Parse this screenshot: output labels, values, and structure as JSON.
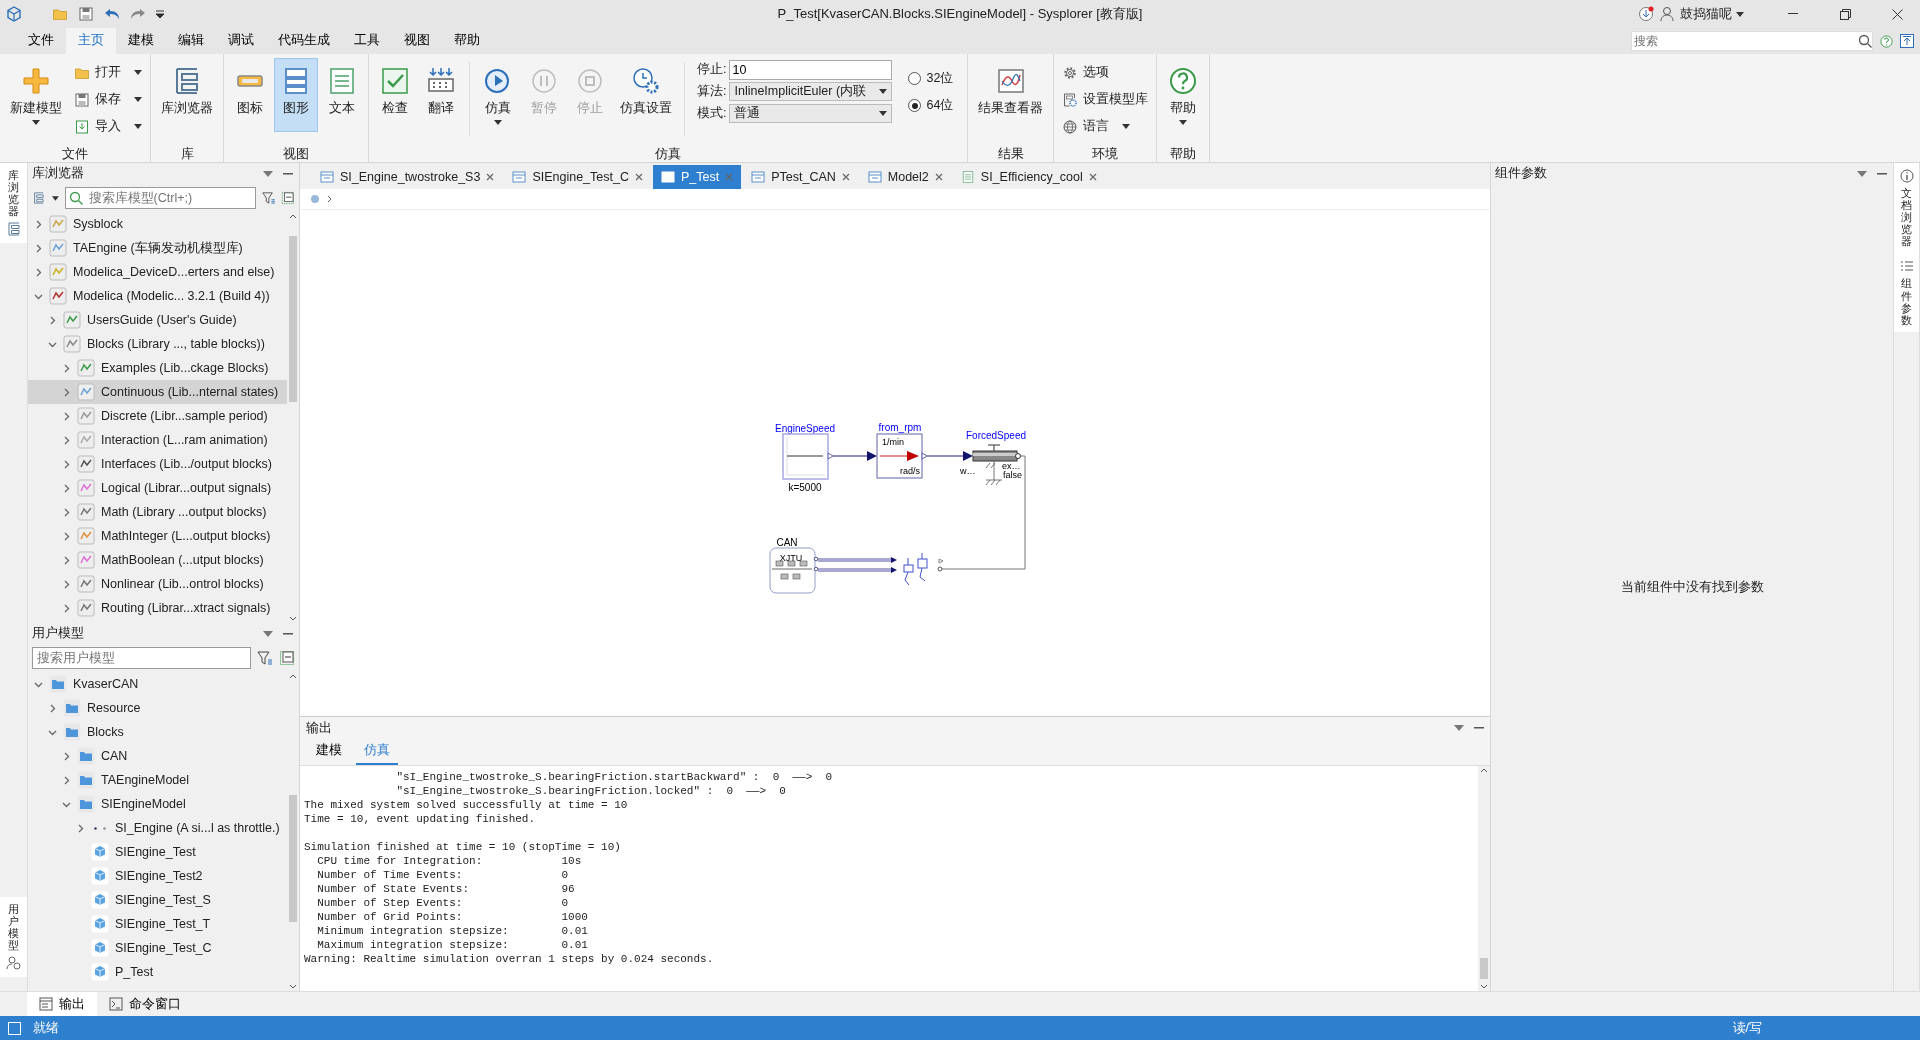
{
  "window": {
    "title": "P_Test[KvaserCAN.Blocks.SIEngineModel] - Sysplorer [教育版]",
    "user": "鼓捣猫呢"
  },
  "menu": [
    {
      "label": "文件",
      "selected": false
    },
    {
      "label": "主页",
      "selected": true
    },
    {
      "label": "建模",
      "selected": false
    },
    {
      "label": "编辑",
      "selected": false
    },
    {
      "label": "调试",
      "selected": false
    },
    {
      "label": "代码生成",
      "selected": false
    },
    {
      "label": "工具",
      "selected": false
    },
    {
      "label": "视图",
      "selected": false
    },
    {
      "label": "帮助",
      "selected": false
    }
  ],
  "search": {
    "placeholder": "搜索"
  },
  "ribbon": [
    {
      "label": "文件",
      "items": [
        {
          "kind": "large",
          "label": "新建模型",
          "dropdown": true
        },
        {
          "kind": "stack",
          "buttons": [
            {
              "label": "打开",
              "dropdown": true
            },
            {
              "label": "保存",
              "dropdown": true
            },
            {
              "label": "导入",
              "dropdown": true
            }
          ]
        }
      ]
    },
    {
      "label": "库",
      "items": [
        {
          "kind": "large",
          "label": "库浏览器",
          "dropdown": false
        }
      ]
    },
    {
      "label": "视图",
      "items": [
        {
          "kind": "large",
          "label": "图标",
          "selected": false
        },
        {
          "kind": "large",
          "label": "图形",
          "selected": true
        },
        {
          "kind": "large",
          "label": "文本",
          "selected": false
        }
      ]
    },
    {
      "label": "仿真",
      "items": [
        {
          "kind": "large",
          "label": "检查"
        },
        {
          "kind": "large",
          "label": "翻译"
        },
        {
          "kind": "divider"
        },
        {
          "kind": "large",
          "label": "仿真",
          "dropdown": true
        },
        {
          "kind": "large",
          "label": "暂停",
          "disabled": true
        },
        {
          "kind": "large",
          "label": "停止",
          "disabled": true
        },
        {
          "kind": "large",
          "label": "仿真设置"
        },
        {
          "kind": "divider"
        },
        {
          "kind": "fields",
          "rows": [
            {
              "label": "停止:",
              "value": "10",
              "dropdown": false
            },
            {
              "label": "算法:",
              "value": "InlineImplicitEuler (内联",
              "dropdown": true
            },
            {
              "label": "模式:",
              "value": "普通",
              "dropdown": true
            }
          ]
        },
        {
          "kind": "radios",
          "options": [
            {
              "label": "32位",
              "selected": false
            },
            {
              "label": "64位",
              "selected": true
            }
          ]
        }
      ]
    },
    {
      "label": "结果",
      "items": [
        {
          "kind": "large",
          "label": "结果查看器"
        }
      ]
    },
    {
      "label": "环境",
      "items": [
        {
          "kind": "stack",
          "buttons": [
            {
              "label": "选项",
              "dropdown": false
            },
            {
              "label": "设置模型库",
              "dropdown": false
            },
            {
              "label": "语言",
              "dropdown": true
            }
          ]
        }
      ]
    },
    {
      "label": "帮助",
      "items": [
        {
          "kind": "large",
          "label": "帮助",
          "dropdown": true
        }
      ]
    }
  ],
  "left_strip": [
    "库浏览器",
    "用户模型"
  ],
  "library": {
    "title": "库浏览器",
    "placeholder": "搜索库模型(Ctrl+;)",
    "items": [
      {
        "label": "Sysblock",
        "expanded": false,
        "selected": false
      },
      {
        "label": "TAEngine (车辆发动机模型库)",
        "expanded": false,
        "selected": false
      },
      {
        "label": "Modelica_DeviceD...erters and else)",
        "expanded": false,
        "selected": false
      },
      {
        "label": "Modelica (Modelic... 3.2.1 (Build 4))",
        "expanded": true,
        "selected": false,
        "children": [
          {
            "label": "UsersGuide (User's Guide)",
            "expanded": false,
            "selected": false
          },
          {
            "label": "Blocks (Library ..., table blocks))",
            "expanded": true,
            "selected": false,
            "children": [
              {
                "label": "Examples (Lib...ckage Blocks)",
                "expanded": false,
                "selected": false
              },
              {
                "label": "Continuous (Lib...nternal states)",
                "expanded": false,
                "selected": true
              },
              {
                "label": "Discrete (Libr...sample period)",
                "expanded": false,
                "selected": false
              },
              {
                "label": "Interaction (L...ram animation)",
                "expanded": false,
                "selected": false
              },
              {
                "label": "Interfaces (Lib.../output blocks)",
                "expanded": false,
                "selected": false
              },
              {
                "label": "Logical (Librar...output signals)",
                "expanded": false,
                "selected": false
              },
              {
                "label": "Math (Library ...output blocks)",
                "expanded": false,
                "selected": false
              },
              {
                "label": "MathInteger (L...output blocks)",
                "expanded": false,
                "selected": false
              },
              {
                "label": "MathBoolean (...utput blocks)",
                "expanded": false,
                "selected": false
              },
              {
                "label": "Nonlinear (Lib...ontrol blocks)",
                "expanded": false,
                "selected": false
              },
              {
                "label": "Routing (Librar...xtract signals)",
                "expanded": false,
                "selected": false
              }
            ]
          }
        ]
      }
    ]
  },
  "user_models": {
    "title": "用户模型",
    "placeholder": "搜索用户模型",
    "items": [
      {
        "label": "KvaserCAN",
        "kind": "folder",
        "expanded": true,
        "children": [
          {
            "label": "Resource",
            "kind": "folder",
            "expanded": false
          },
          {
            "label": "Blocks",
            "kind": "folder",
            "expanded": true,
            "children": [
              {
                "label": "CAN",
                "kind": "folder",
                "expanded": false
              },
              {
                "label": "TAEngineModel",
                "kind": "folder",
                "expanded": false
              },
              {
                "label": "SIEngineModel",
                "kind": "folder",
                "expanded": true,
                "children": [
                  {
                    "label": "SI_Engine (A si...l as throttle.)",
                    "kind": "class",
                    "expanded": false
                  },
                  {
                    "label": "SIEngine_Test",
                    "kind": "model"
                  },
                  {
                    "label": "SIEngine_Test2",
                    "kind": "model"
                  },
                  {
                    "label": "SIEngine_Test_S",
                    "kind": "model"
                  },
                  {
                    "label": "SIEngine_Test_T",
                    "kind": "model"
                  },
                  {
                    "label": "SIEngine_Test_C",
                    "kind": "model"
                  },
                  {
                    "label": "P_Test",
                    "kind": "model"
                  }
                ]
              }
            ]
          }
        ]
      }
    ]
  },
  "doc_tabs": [
    {
      "label": "SI_Engine_twostroke_S3",
      "kind": "diagram",
      "selected": false
    },
    {
      "label": "SIEngine_Test_C",
      "kind": "diagram",
      "selected": false
    },
    {
      "label": "P_Test",
      "kind": "diagram",
      "selected": true
    },
    {
      "label": "PTest_CAN",
      "kind": "diagram",
      "selected": false
    },
    {
      "label": "Model2",
      "kind": "diagram",
      "selected": false
    },
    {
      "label": "SI_Efficiency_cool",
      "kind": "text",
      "selected": false
    }
  ],
  "diagram": {
    "blocks": [
      {
        "kind": "constant",
        "label": "EngineSpeed",
        "texts": [
          "k=5000"
        ]
      },
      {
        "kind": "conversion",
        "label": "from_rpm",
        "texts": [
          "1/min",
          "rad/s"
        ]
      },
      {
        "kind": "speed-source",
        "label": "ForcedSpeed",
        "texts": [
          "w…",
          "ex…",
          "false"
        ]
      },
      {
        "kind": "can-bus",
        "label": "CAN",
        "texts": [
          "XJTU"
        ]
      },
      {
        "kind": "pistons"
      }
    ]
  },
  "output": {
    "title": "输出",
    "tabs": [
      {
        "label": "建模",
        "selected": false
      },
      {
        "label": "仿真",
        "selected": true
      }
    ],
    "log": [
      [
        "              \"sI_Engine_twostroke_S.bearingFriction.startBackward\" :  0  ——>  0",
        "              \"sI_Engine_twostroke_S.bearingFriction.locked\" :  0  ——>  0",
        "The mixed system solved successfully at time = 10",
        "Time = 10, event updating finished."
      ],
      [
        "Simulation finished at time = 10 (stopTime = 10)",
        "  CPU time for Integration:            10s",
        "  Number of Time Events:               0",
        "  Number of State Events:              96",
        "  Number of Step Events:               0",
        "  Number of Grid Points:               1000",
        "  Minimum integration stepsize:        0.01",
        "  Maximum integration stepsize:        0.01",
        "Warning: Realtime simulation overran 1 steps by 0.024 seconds."
      ]
    ]
  },
  "parameters": {
    "title": "组件参数",
    "message": "当前组件中没有找到参数"
  },
  "right_strip": [
    "文档浏览器",
    "组件参数"
  ],
  "bottom_tabs": [
    {
      "label": "输出",
      "selected": true
    },
    {
      "label": "命令窗口",
      "selected": false
    }
  ],
  "status": {
    "left": "就绪",
    "right": "读/写"
  }
}
